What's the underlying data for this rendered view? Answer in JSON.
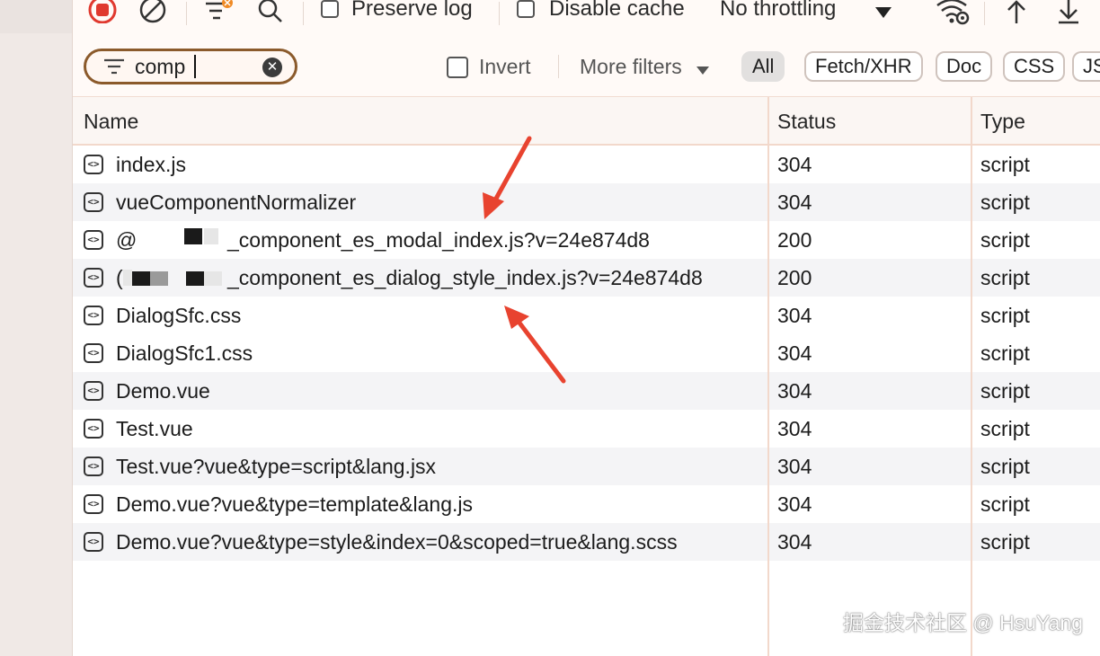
{
  "toolbar": {
    "preserve_log_label": "Preserve log",
    "disable_cache_label": "Disable cache",
    "throttling_label": "No throttling"
  },
  "filter": {
    "search_value": "comp",
    "invert_label": "Invert",
    "more_filters_label": "More filters",
    "type_chips": [
      "All",
      "Fetch/XHR",
      "Doc",
      "CSS",
      "JS"
    ]
  },
  "table": {
    "headers": {
      "name": "Name",
      "status": "Status",
      "type": "Type"
    },
    "rows": [
      {
        "name": "index.js",
        "status": "304",
        "type": "script"
      },
      {
        "name": "vueComponentNormalizer",
        "status": "304",
        "type": "script"
      },
      {
        "name": "@",
        "name_suffix": "_component_es_modal_index.js?v=24e874d8",
        "status": "200",
        "type": "script"
      },
      {
        "name": "(",
        "name_suffix": "_component_es_dialog_style_index.js?v=24e874d8",
        "status": "200",
        "type": "script"
      },
      {
        "name": "DialogSfc.css",
        "status": "304",
        "type": "script"
      },
      {
        "name": "DialogSfc1.css",
        "status": "304",
        "type": "script"
      },
      {
        "name": "Demo.vue",
        "status": "304",
        "type": "script"
      },
      {
        "name": "Test.vue",
        "status": "304",
        "type": "script"
      },
      {
        "name": "Test.vue?vue&type=script&lang.jsx",
        "status": "304",
        "type": "script"
      },
      {
        "name": "Demo.vue?vue&type=template&lang.js",
        "status": "304",
        "type": "script"
      },
      {
        "name": "Demo.vue?vue&type=style&index=0&scoped=true&lang.scss",
        "status": "304",
        "type": "script"
      }
    ]
  },
  "watermark": "掘金技术社区 @ HsuYang",
  "colors": {
    "accent": "#8b5a2b",
    "record_red": "#e0392f",
    "arrow_red": "#e8432f"
  }
}
